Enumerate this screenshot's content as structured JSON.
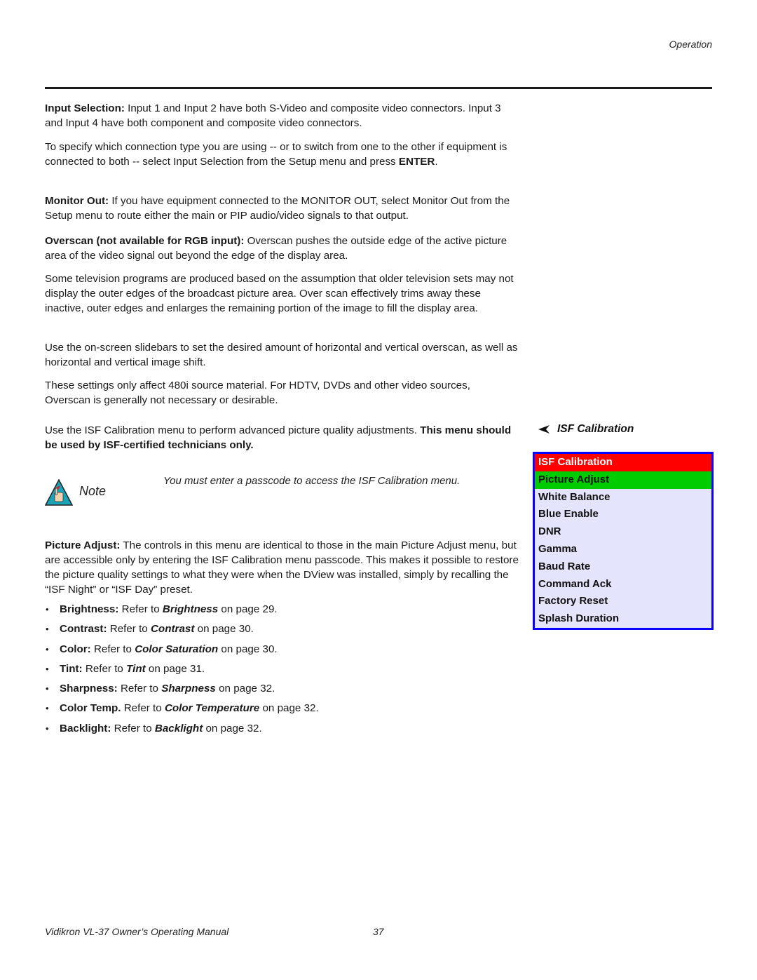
{
  "header": {
    "section": "Operation"
  },
  "paragraphs": {
    "input_selection": {
      "label": "Input Selection:",
      "text": " Input 1 and Input 2 have both S-Video and composite video connectors. Input 3 and Input 4 have both component and composite video connectors."
    },
    "specify": {
      "text": "To specify which connection type you are using -- or to switch from one to the other if equipment is connected to both -- select Input Selection from the Setup menu and press ",
      "key": "ENTER",
      "end": "."
    },
    "monitor_out": {
      "label": "Monitor Out:",
      "text": " If you have equipment connected to the MONITOR OUT, select Monitor Out from the Setup menu to route either the main or PIP audio/video signals to that output."
    },
    "overscan": {
      "label": "Overscan (not available for RGB input):",
      "text": " Overscan pushes the outside edge of the active picture area of the video signal out beyond the edge of the display area."
    },
    "overscan_explain": {
      "text": "Some television programs are produced based on the assumption that older television sets may not display the outer edges of the broadcast picture area. Over scan effectively trims away these inactive, outer edges and enlarges the remaining portion of the image to fill the display area."
    },
    "slidebars": {
      "text": "Use the on-screen slidebars to set the desired amount of horizontal and vertical overscan, as well as horizontal and vertical image shift."
    },
    "settings_480i": {
      "text": "These settings only affect 480i source material. For HDTV, DVDs and other video sources, Overscan is generally not necessary or desirable."
    },
    "isf_intro": {
      "text": "Use the ISF Calibration menu to perform advanced picture quality adjustments. ",
      "bold": "This menu should be used by ISF-certified technicians only."
    },
    "picture_adjust": {
      "label": "Picture Adjust:",
      "text": " The controls in this menu are identical to those in the main Picture Adjust menu, but are accessible only by entering the ISF Calibration menu passcode. This makes it possible to restore the picture quality settings to what they were when the DView was installed, simply by recalling the “ISF Night” or “ISF Day” preset."
    }
  },
  "note": {
    "label": "Note",
    "text": "You must enter a passcode to access the ISF Calibration menu."
  },
  "bullets": [
    {
      "label": "Brightness:",
      "pre": " Refer to ",
      "ref": "Brightness",
      "post": " on page 29."
    },
    {
      "label": "Contrast:",
      "pre": " Refer to ",
      "ref": "Contrast",
      "post": " on page 30."
    },
    {
      "label": "Color:",
      "pre": " Refer to ",
      "ref": "Color Saturation",
      "post": " on page 30."
    },
    {
      "label": "Tint:",
      "pre": " Refer to ",
      "ref": "Tint",
      "post": " on page 31."
    },
    {
      "label": "Sharpness:",
      "pre": " Refer to ",
      "ref": "Sharpness",
      "post": " on page 32."
    },
    {
      "label": "Color Temp.",
      "pre": " Refer to ",
      "ref": "Color Temperature",
      "post": " on page 32."
    },
    {
      "label": "Backlight:",
      "pre": " Refer to ",
      "ref": "Backlight",
      "post": " on page 32."
    }
  ],
  "sidebar": {
    "heading": "ISF Calibration",
    "menu": {
      "title": "ISF Calibration",
      "items": [
        "Picture Adjust",
        "White Balance",
        "Blue Enable",
        "DNR",
        "Gamma",
        "Baud Rate",
        "Command Ack",
        "Factory Reset",
        "Splash Duration"
      ],
      "selected": "Picture Adjust",
      "colors": {
        "border": "#0a00ff",
        "title_bg": "#ff0000",
        "selected_bg": "#00cc00",
        "body_bg": "#e4e4fc"
      }
    }
  },
  "footer": {
    "manual_title": "Vidikron VL-37 Owner’s Operating Manual",
    "page_number": "37"
  }
}
